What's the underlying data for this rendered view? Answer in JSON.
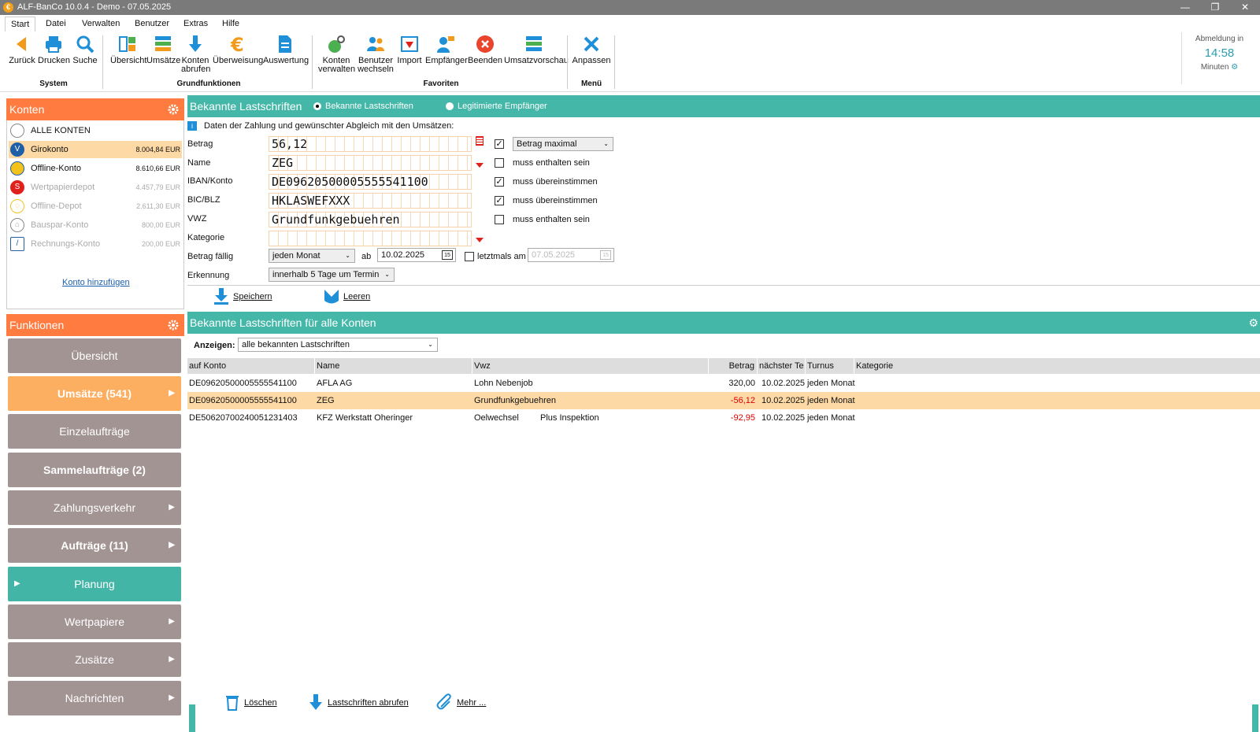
{
  "window": {
    "title": "ALF-BanCo 10.0.4 - Demo  -  07.05.2025"
  },
  "menu": [
    "Start",
    "Datei",
    "Verwalten",
    "Benutzer",
    "Extras",
    "Hilfe"
  ],
  "ribbon": {
    "system": {
      "label": "System",
      "buttons": [
        "Zurück",
        "Drucken",
        "Suche"
      ]
    },
    "grundfunktionen": {
      "label": "Grundfunktionen",
      "buttons": [
        "Übersicht",
        "Umsätze",
        "Konten\nabrufen",
        "Überweisung",
        "Auswertung"
      ]
    },
    "favoriten": {
      "label": "Favoriten",
      "buttons": [
        "Konten\nverwalten",
        "Benutzer\nwechseln",
        "Import",
        "Empfänger",
        "Beenden",
        "Umsatzvorschau"
      ]
    },
    "menu_group": {
      "label": "Menü",
      "buttons": [
        "Anpassen"
      ]
    },
    "konten_abrufen_line1": "Konten",
    "konten_abrufen_line2": "abrufen",
    "konten_verwalten_line1": "Konten",
    "konten_verwalten_line2": "verwalten",
    "benutzer_wechseln_line1": "Benutzer",
    "benutzer_wechseln_line2": "wechseln"
  },
  "logout": {
    "label": "Abmeldung in",
    "time": "14:58",
    "unit": "Minuten"
  },
  "konten": {
    "title": "Konten",
    "items": [
      {
        "name": "ALLE KONTEN",
        "amount": ""
      },
      {
        "name": "Girokonto",
        "amount": "8.004,84 EUR"
      },
      {
        "name": "Offline-Konto",
        "amount": "8.610,66 EUR"
      },
      {
        "name": "Wertpapierdepot",
        "amount": "4.457,79 EUR"
      },
      {
        "name": "Offline-Depot",
        "amount": "2.611,30 EUR"
      },
      {
        "name": "Bauspar-Konto",
        "amount": "800,00 EUR"
      },
      {
        "name": "Rechnungs-Konto",
        "amount": "200,00 EUR"
      }
    ],
    "add": "Konto hinzufügen"
  },
  "funktionen": {
    "title": "Funktionen",
    "items": [
      "Übersicht",
      "Umsätze (541)",
      "Einzelaufträge",
      "Sammelaufträge (2)",
      "Zahlungsverkehr",
      "Aufträge (11)",
      "Planung",
      "Wertpapiere",
      "Zusätze",
      "Nachrichten"
    ]
  },
  "form": {
    "header": "Bekannte Lastschriften",
    "radio1": "Bekannte Lastschriften",
    "radio2": "Legitimierte Empfänger",
    "info": "Daten der Zahlung und gewünschter Abgleich mit den Umsätzen:",
    "labels": {
      "betrag": "Betrag",
      "name": "Name",
      "iban": "IBAN/Konto",
      "bic": "BIC/BLZ",
      "vwz": "VWZ",
      "kategorie": "Kategorie",
      "faellig": "Betrag fällig",
      "erkennung": "Erkennung",
      "ab": "ab",
      "letztmals": "letztmals am"
    },
    "values": {
      "betrag": "56,12",
      "name": "ZEG",
      "iban": "DE09620500005555541100",
      "bic": "HKLASWEFXXX",
      "vwz": "Grundfunkgebuehren",
      "kategorie": ""
    },
    "betrag_mode": "Betrag maximal",
    "checks": {
      "name": "muss enthalten sein",
      "iban": "muss übereinstimmen",
      "bic": "muss übereinstimmen",
      "vwz": "muss enthalten sein"
    },
    "faellig": "jeden Monat",
    "ab_date": "10.02.2025",
    "letztmals_date": "07.05.2025",
    "erkennung": "innerhalb 5 Tage um Termin",
    "save": "Speichern",
    "clear": "Leeren"
  },
  "list": {
    "header": "Bekannte Lastschriften für alle Konten",
    "show_label": "Anzeigen:",
    "show_value": "alle bekannten Lastschriften",
    "columns": [
      "auf Konto",
      "Name",
      "Vwz",
      "Betrag",
      "nächster Te",
      "Turnus",
      "Kategorie"
    ],
    "rows": [
      {
        "konto": "DE09620500005555541100",
        "name": "AFLA AG",
        "vwz": "Lohn Nebenjob",
        "vwz2": "",
        "betrag": "320,00",
        "next": "10.02.2025",
        "turnus": "jeden Monat",
        "kategorie": ""
      },
      {
        "konto": "DE09620500005555541100",
        "name": "ZEG",
        "vwz": "Grundfunkgebuehren",
        "vwz2": "",
        "betrag": "-56,12",
        "next": "10.02.2025",
        "turnus": "jeden Monat",
        "kategorie": ""
      },
      {
        "konto": "DE50620700240051231403",
        "name": "KFZ Werkstatt Oheringer",
        "vwz": "Oelwechsel",
        "vwz2": "Plus Inspektion",
        "betrag": "-92,95",
        "next": "10.02.2025",
        "turnus": "jeden Monat",
        "kategorie": ""
      }
    ]
  },
  "bottom": {
    "delete": "Löschen",
    "fetch": "Lastschriften abrufen",
    "more": "Mehr ..."
  },
  "colors": {
    "teal": "#44b7a8",
    "orange": "#ff7b3f",
    "selected": "#fdd9a5",
    "negative": "#dd0000"
  }
}
